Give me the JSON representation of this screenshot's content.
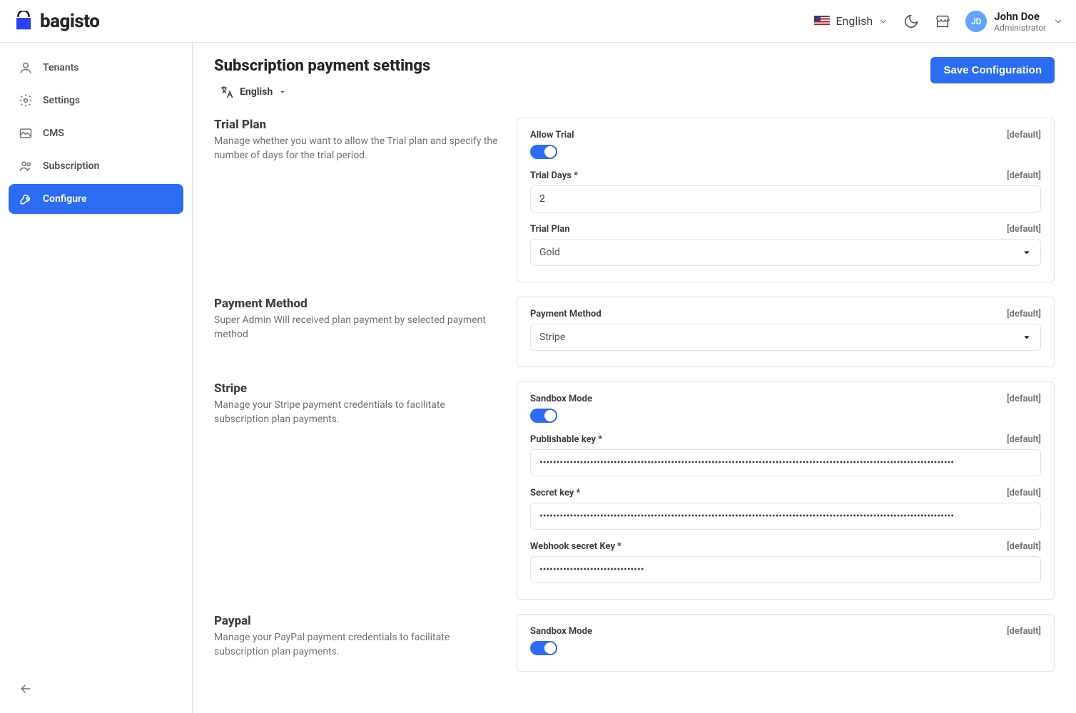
{
  "brand": "bagisto",
  "header": {
    "language": "English",
    "user_name": "John Doe",
    "user_role": "Administrator",
    "avatar_initials": "JD"
  },
  "sidebar": {
    "items": [
      {
        "label": "Tenants"
      },
      {
        "label": "Settings"
      },
      {
        "label": "CMS"
      },
      {
        "label": "Subscription"
      },
      {
        "label": "Configure"
      }
    ]
  },
  "page": {
    "title": "Subscription payment settings",
    "save_button": "Save Configuration",
    "lang_chip": "English"
  },
  "default_tag": "[default]",
  "sections": {
    "trial": {
      "title": "Trial Plan",
      "desc": "Manage whether you want to allow the Trial plan and specify the number of days for the trial period.",
      "allow_trial_label": "Allow Trial",
      "trial_days_label": "Trial Days",
      "trial_days_value": "2",
      "trial_plan_label": "Trial Plan",
      "trial_plan_value": "Gold"
    },
    "payment_method": {
      "title": "Payment Method",
      "desc": "Super Admin Will received plan payment by selected payment method",
      "label": "Payment Method",
      "value": "Stripe"
    },
    "stripe": {
      "title": "Stripe",
      "desc": "Manage your Stripe payment credentials to facilitate subscription plan payments.",
      "sandbox_label": "Sandbox Mode",
      "pub_key_label": "Publishable key",
      "secret_key_label": "Secret key",
      "webhook_label": "Webhook secret Key",
      "pub_key_value": "•••••••••••••••••••••••••••••••••••••••••••••••••••••••••••••••••••••••••••••••••••••••••••••••••••••••••••••••••••••••••••",
      "secret_key_value": "•••••••••••••••••••••••••••••••••••••••••••••••••••••••••••••••••••••••••••••••••••••••••••••••••••••••••••••••••••••••••••",
      "webhook_value": "•••••••••••••••••••••••••••••••"
    },
    "paypal": {
      "title": "Paypal",
      "desc": "Manage your PayPal payment credentials to facilitate subscription plan payments.",
      "sandbox_label": "Sandbox Mode"
    }
  }
}
